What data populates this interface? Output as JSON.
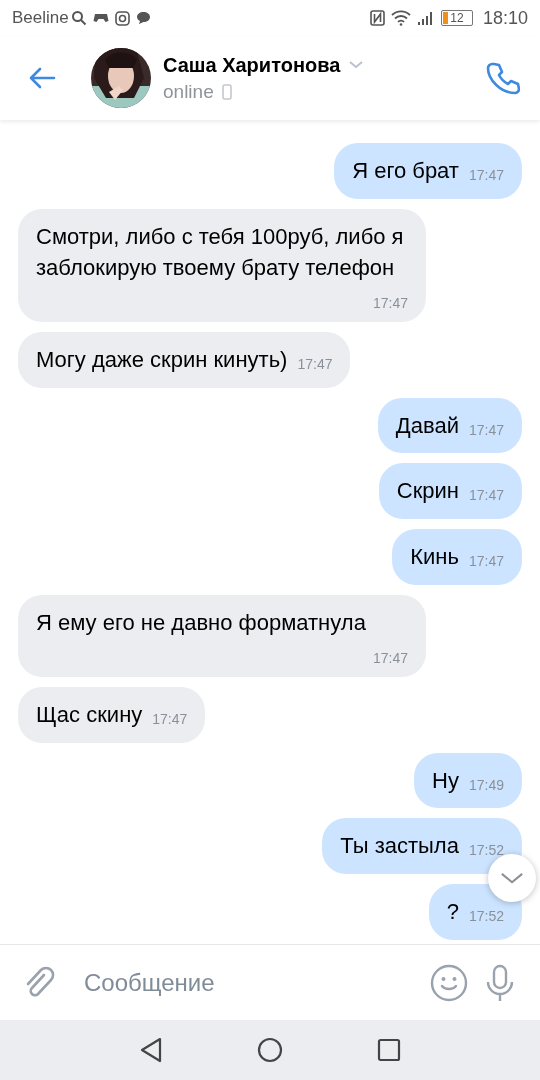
{
  "status_bar": {
    "carrier": "Beeline",
    "battery": "12",
    "time": "18:10"
  },
  "header": {
    "name": "Саша Харитонова",
    "status": "online"
  },
  "messages": [
    {
      "text": "Я его брат",
      "time": "17:47",
      "outgoing": true
    },
    {
      "text": "Смотри, либо с тебя 100руб, либо я заблокирую твоему брату телефон",
      "time": "17:47",
      "outgoing": false
    },
    {
      "text": "Могу даже скрин кинуть)",
      "time": "17:47",
      "outgoing": false
    },
    {
      "text": "Давай",
      "time": "17:47",
      "outgoing": true
    },
    {
      "text": "Скрин",
      "time": "17:47",
      "outgoing": true
    },
    {
      "text": "Кинь",
      "time": "17:47",
      "outgoing": true
    },
    {
      "text": "Я ему его не давно форматнула",
      "time": "17:47",
      "outgoing": false
    },
    {
      "text": "Щас скину",
      "time": "17:47",
      "outgoing": false
    },
    {
      "text": "Ну",
      "time": "17:49",
      "outgoing": true
    },
    {
      "text": "Ты застыла",
      "time": "17:52",
      "outgoing": true
    },
    {
      "text": "?",
      "time": "17:52",
      "outgoing": true
    }
  ],
  "composer": {
    "placeholder": "Сообщение"
  }
}
